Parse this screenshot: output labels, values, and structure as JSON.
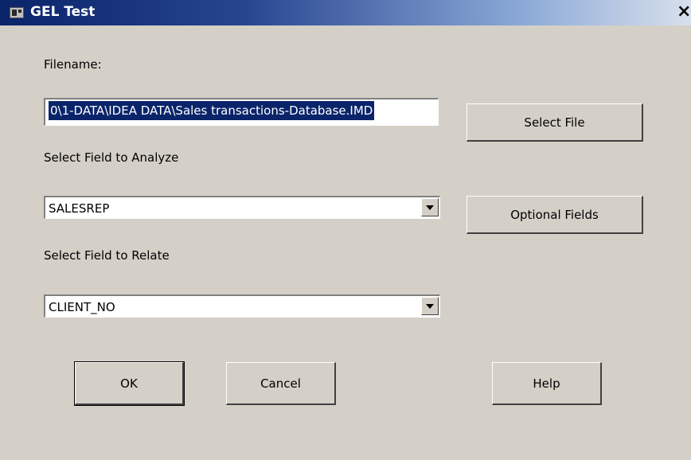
{
  "window": {
    "title": "GEL Test",
    "close_glyph": "×"
  },
  "filename": {
    "label": "Filename:",
    "value": "0\\1-DATA\\IDEA DATA\\Sales transactions-Database.IMD"
  },
  "select_file_label": "Select File",
  "analyze": {
    "label": "Select Field to Analyze",
    "value": "SALESREP"
  },
  "optional_fields_label": "Optional Fields",
  "relate": {
    "label": "Select Field to Relate",
    "value": "CLIENT_NO"
  },
  "buttons": {
    "ok": "OK",
    "cancel": "Cancel",
    "help": "Help"
  }
}
